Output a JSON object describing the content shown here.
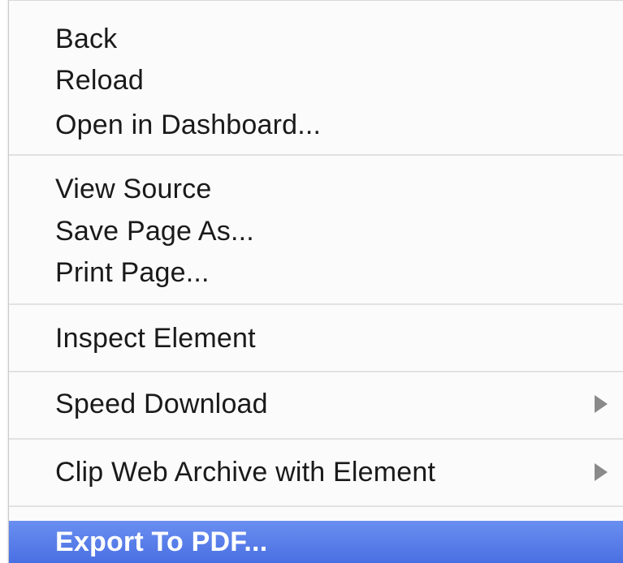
{
  "context_menu": {
    "groups": [
      {
        "items": [
          {
            "label": "Back"
          },
          {
            "label": "Reload"
          },
          {
            "label": "Open in Dashboard..."
          }
        ]
      },
      {
        "items": [
          {
            "label": "View Source"
          },
          {
            "label": "Save Page As..."
          },
          {
            "label": "Print Page..."
          }
        ]
      },
      {
        "items": [
          {
            "label": "Inspect Element"
          }
        ]
      },
      {
        "items": [
          {
            "label": "Speed Download",
            "submenu": true
          }
        ]
      },
      {
        "items": [
          {
            "label": "Clip Web Archive with Element",
            "submenu": true
          }
        ]
      },
      {
        "items": [
          {
            "label": "Export To PDF...",
            "highlighted": true
          }
        ]
      }
    ],
    "highlight_color": "#5179e8",
    "submenu_arrow_icon": "triangle-right-icon"
  }
}
